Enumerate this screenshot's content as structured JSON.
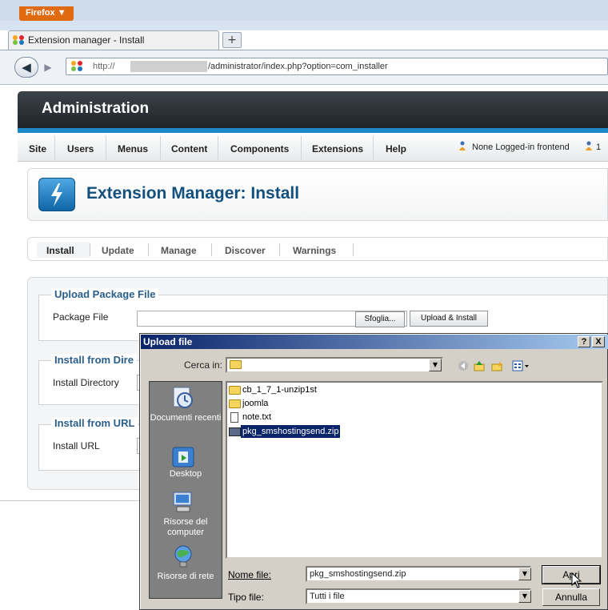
{
  "browser": {
    "menu_button": "Firefox ▼",
    "tab_title": "Extension manager - Install",
    "new_tab_symbol": "+",
    "back_symbol": "◀",
    "forward_symbol": "▶",
    "url_scheme": "http://",
    "url_path": "/administrator/index.php?option=com_installer"
  },
  "admin": {
    "header_title": "Administration",
    "menu": [
      "Site",
      "Users",
      "Menus",
      "Content",
      "Components",
      "Extensions",
      "Help"
    ],
    "status_logged": "None Logged-in frontend",
    "status_count": "1",
    "page_title": "Extension Manager: Install",
    "subtabs": [
      "Install",
      "Update",
      "Manage",
      "Discover",
      "Warnings"
    ],
    "upload_legend": "Upload Package File",
    "package_file_label": "Package File",
    "browse_button": "Sfoglia...",
    "upload_install_button": "Upload & Install",
    "dir_legend": "Install from Dire",
    "dir_label": "Install Directory",
    "url_legend": "Install from URL",
    "url_label": "Install URL"
  },
  "dialog": {
    "title": "Upload file",
    "help_btn": "?",
    "close_btn": "X",
    "lookin_label": "Cerca in:",
    "places": [
      "Documenti recenti",
      "Desktop",
      "Risorse del computer",
      "Risorse di rete"
    ],
    "files": [
      {
        "name": "cb_1_7_1-unzip1st",
        "type": "folder"
      },
      {
        "name": "joomla",
        "type": "folder"
      },
      {
        "name": "note.txt",
        "type": "text"
      },
      {
        "name": "pkg_smshostingsend.zip",
        "type": "zip",
        "selected": true
      }
    ],
    "filename_label": "Nome file:",
    "filename_value": "pkg_smshostingsend.zip",
    "filetype_label": "Tipo file:",
    "filetype_value": "Tutti i file",
    "open_button": "Apri",
    "cancel_button": "Annulla",
    "combo_arrow": "▼"
  }
}
